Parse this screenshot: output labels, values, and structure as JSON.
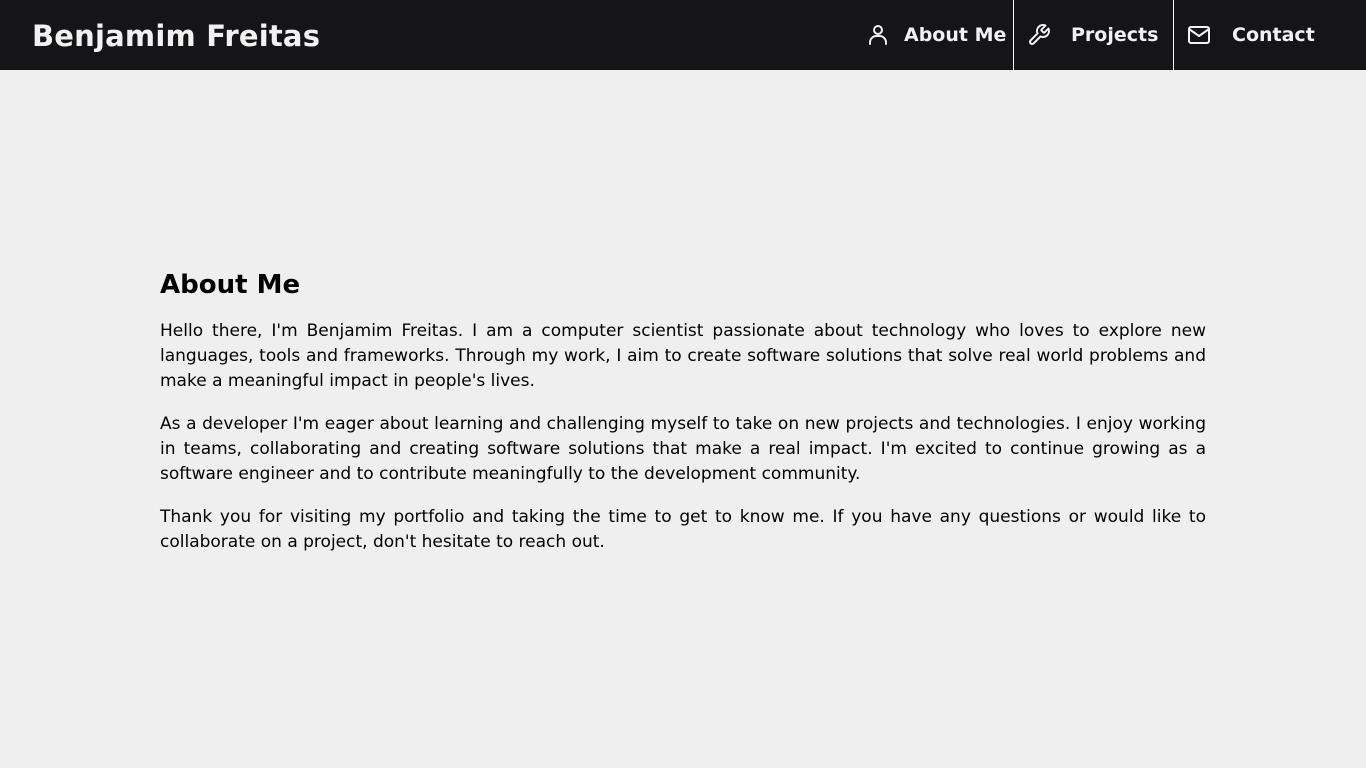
{
  "header": {
    "brand": "Benjamim Freitas",
    "nav": [
      {
        "label": "About Me",
        "icon": "user-icon"
      },
      {
        "label": "Projects",
        "icon": "wrench-icon"
      },
      {
        "label": "Contact",
        "icon": "mail-icon"
      }
    ]
  },
  "about": {
    "title": "About Me",
    "paragraphs": [
      "Hello there, I'm Benjamim Freitas. I am a computer scientist passionate about technology who loves to explore new languages, tools and frameworks. Through my work, I aim to create software solutions that solve real world problems and make a meaningful impact in people's lives.",
      "As a developer I'm eager about learning and challenging myself to take on new projects and technologies. I enjoy working in teams, collaborating and creating software solutions that make a real impact. I'm excited to continue growing as a software engineer and to contribute meaningfully to the development community.",
      "Thank you for visiting my portfolio and taking the time to get to know me. If you have any questions or would like to collaborate on a project, don't hesitate to reach out."
    ]
  },
  "colors": {
    "header_bg": "#141419",
    "page_bg": "#efefef",
    "text": "#000000",
    "header_text": "#f2f2f2"
  }
}
